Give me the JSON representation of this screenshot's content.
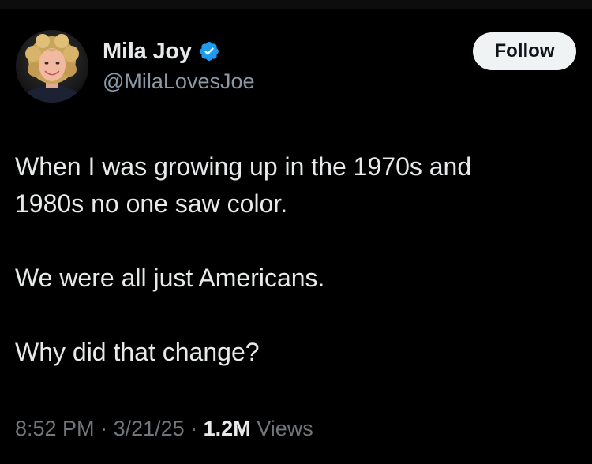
{
  "author": {
    "display_name": "Mila Joy",
    "handle": "@MilaLovesJoe",
    "verified": true
  },
  "follow_button": {
    "label": "Follow"
  },
  "tweet": {
    "paragraphs": [
      [
        "When I was growing up in the 1970s and",
        "1980s no one saw color."
      ],
      [
        "We were all just Americans."
      ],
      [
        "Why did that change?"
      ]
    ]
  },
  "meta": {
    "time": "8:52 PM",
    "sep1": " · ",
    "date": "3/21/25",
    "sep2": " · ",
    "views_count": "1.2M",
    "views_label": " Views"
  },
  "colors": {
    "background": "#000000",
    "text_primary": "#e7e9ea",
    "text_secondary": "#71767b",
    "verified_blue": "#1d9bf0",
    "follow_button_bg": "#eff3f4"
  },
  "icons": {
    "verified": "verified-badge-icon"
  }
}
